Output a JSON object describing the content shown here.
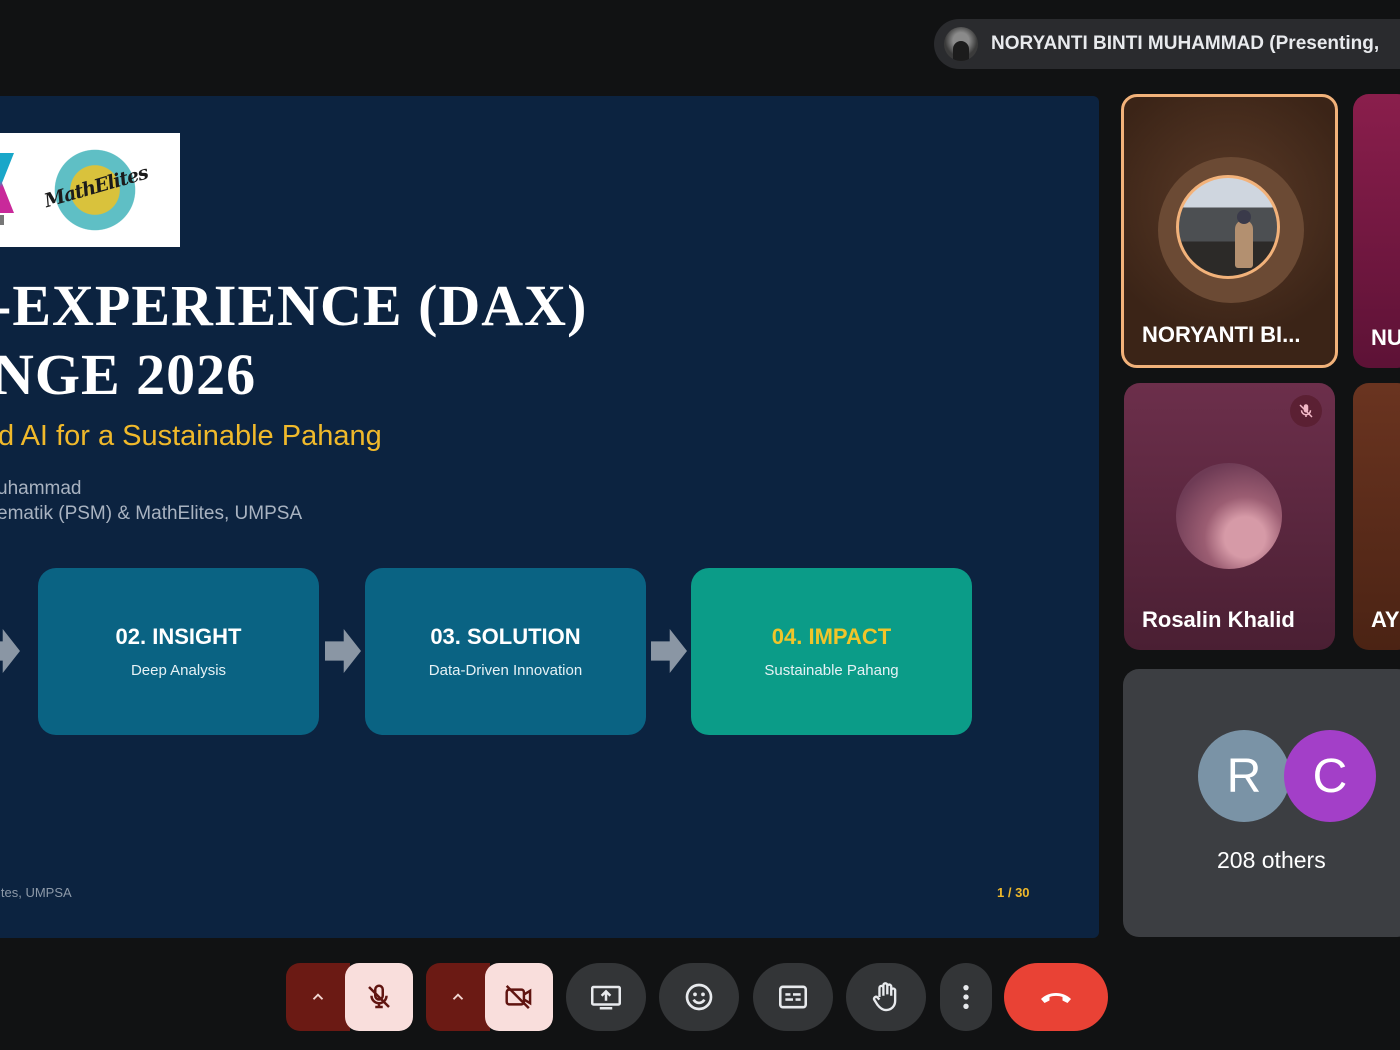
{
  "presenter_chip": {
    "text": "NORYANTI BINTI MUHAMMAD (Presenting,"
  },
  "slide": {
    "logo_text": "MathElites",
    "title_line1": "-EXPERIENCE (DAX)",
    "title_line2": "NGE 2026",
    "subtitle": "d AI for a Sustainable Pahang",
    "author": "uhammad",
    "affiliation": "ematik (PSM) & MathElites, UMPSA",
    "steps": [
      {
        "title": "02. INSIGHT",
        "subtitle": "Deep Analysis"
      },
      {
        "title": "03. SOLUTION",
        "subtitle": "Data-Driven Innovation"
      },
      {
        "title": "04. IMPACT",
        "subtitle": "Sustainable Pahang"
      }
    ],
    "footer_left": "ites, UMPSA",
    "page_number": "1 / 30"
  },
  "participants": {
    "noryanti": {
      "name": "NORYANTI BI..."
    },
    "nu": {
      "name": "NU"
    },
    "rosalin": {
      "name": "Rosalin Khalid",
      "muted": true
    },
    "ay": {
      "name": "AY"
    },
    "others": {
      "avatars": [
        "R",
        "C"
      ],
      "avatar_colors": [
        "#7a93a6",
        "#a33fc8"
      ],
      "label": "208 others"
    }
  },
  "controls": {
    "mic": {
      "state": "off",
      "icon": "mic-off-icon"
    },
    "camera": {
      "state": "off",
      "icon": "camera-off-icon"
    },
    "present": {
      "icon": "present-screen-icon"
    },
    "reactions": {
      "icon": "emoji-icon"
    },
    "captions": {
      "icon": "captions-icon"
    },
    "raise_hand": {
      "icon": "hand-icon"
    },
    "more": {
      "icon": "more-vert-icon"
    },
    "end_call": {
      "icon": "call-end-icon",
      "color": "#e94235"
    }
  },
  "colors": {
    "slide_bg": "#0c2340",
    "accent_gold": "#f0b92b",
    "step_blue": "#0a6383",
    "step_teal": "#0b9c88",
    "active_speaker_border": "#f2b27a"
  }
}
